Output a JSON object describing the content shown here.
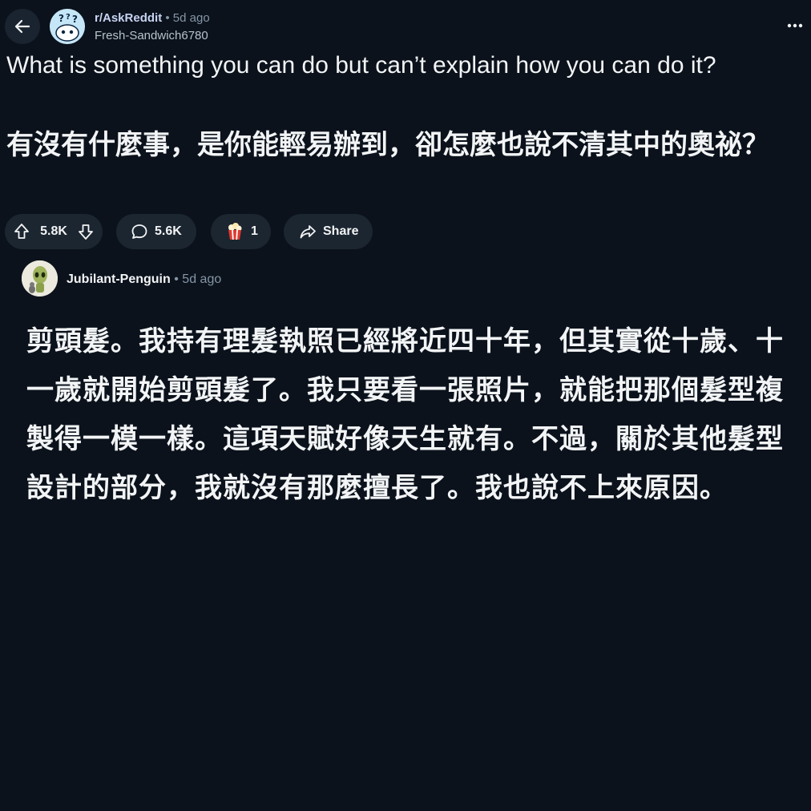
{
  "header": {
    "back_icon": "arrow-left-icon",
    "subreddit": "r/AskReddit",
    "separator": "•",
    "post_age": "5d ago",
    "author": "Fresh-Sandwich6780",
    "more_icon": "more-horizontal-icon"
  },
  "post": {
    "title": "What is something you can do but can’t explain how you can do it?",
    "title_zh": "有沒有什麼事，是你能輕易辦到，卻怎麼也說不清其中的奧祕？"
  },
  "actions": {
    "upvotes": "5.8K",
    "comments": "5.6K",
    "awards": "1",
    "share_label": "Share"
  },
  "comment": {
    "author": "Jubilant-Penguin",
    "separator": "•",
    "age": "5d ago",
    "body": "剪頭髮。我持有理髮執照已經將近四十年，但其實從十歲、十一歲就開始剪頭髮了。我只要看一張照片，就能把那個髮型複製得一模一樣。這項天賦好像天生就有。不過，關於其他髮型設計的部分，我就沒有那麼擅長了。我也說不上來原因。"
  },
  "colors": {
    "background": "#0b121c",
    "pill": "#1c2631",
    "subreddit_text": "#c7d4f2",
    "dim_text": "#8495a5"
  }
}
